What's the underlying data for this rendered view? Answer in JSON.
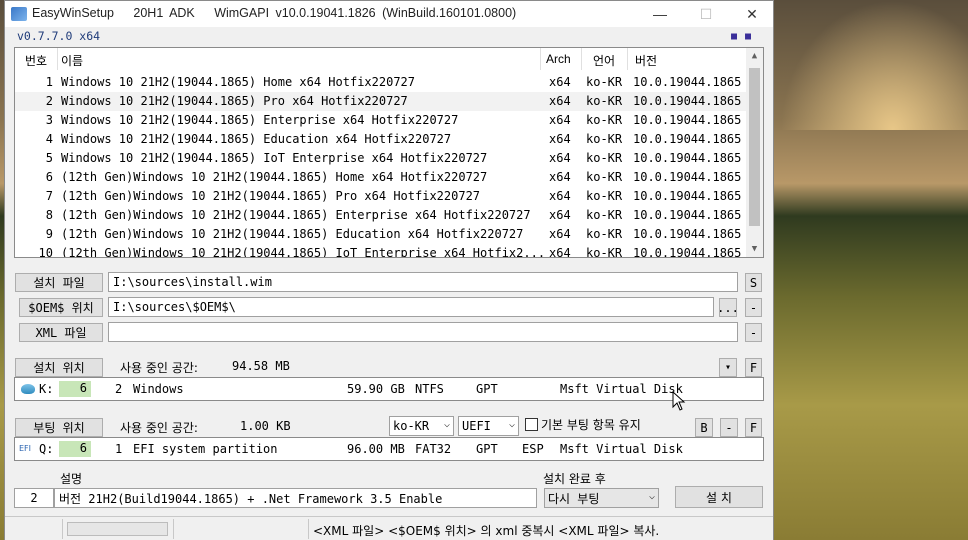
{
  "window": {
    "title": "EasyWinSetup   20H1 ADK   WimGAPI v10.0.19041.1826 (WinBuild.160101.0800)",
    "minimize": "—",
    "maximize": "☐",
    "close": "✕"
  },
  "version": "v0.7.7.0 x64",
  "menu_dots": "■■",
  "list": {
    "headers": {
      "no": "번호",
      "name": "이름",
      "arch": "Arch",
      "lang": "언어",
      "ver": "버전"
    },
    "rows": [
      {
        "no": "1",
        "name": "Windows 10 21H2(19044.1865) Home x64 Hotfix220727",
        "arch": "x64",
        "lang": "ko-KR",
        "ver": "10.0.19044.1865"
      },
      {
        "no": "2",
        "name": "Windows 10 21H2(19044.1865) Pro x64 Hotfix220727",
        "arch": "x64",
        "lang": "ko-KR",
        "ver": "10.0.19044.1865"
      },
      {
        "no": "3",
        "name": "Windows 10 21H2(19044.1865) Enterprise x64 Hotfix220727",
        "arch": "x64",
        "lang": "ko-KR",
        "ver": "10.0.19044.1865"
      },
      {
        "no": "4",
        "name": "Windows 10 21H2(19044.1865) Education x64 Hotfix220727",
        "arch": "x64",
        "lang": "ko-KR",
        "ver": "10.0.19044.1865"
      },
      {
        "no": "5",
        "name": "Windows 10 21H2(19044.1865) IoT Enterprise x64 Hotfix220727",
        "arch": "x64",
        "lang": "ko-KR",
        "ver": "10.0.19044.1865"
      },
      {
        "no": "6",
        "name": "(12th Gen)Windows 10 21H2(19044.1865) Home x64 Hotfix220727",
        "arch": "x64",
        "lang": "ko-KR",
        "ver": "10.0.19044.1865"
      },
      {
        "no": "7",
        "name": "(12th Gen)Windows 10 21H2(19044.1865) Pro x64 Hotfix220727",
        "arch": "x64",
        "lang": "ko-KR",
        "ver": "10.0.19044.1865"
      },
      {
        "no": "8",
        "name": "(12th Gen)Windows 10 21H2(19044.1865) Enterprise x64 Hotfix220727",
        "arch": "x64",
        "lang": "ko-KR",
        "ver": "10.0.19044.1865"
      },
      {
        "no": "9",
        "name": "(12th Gen)Windows 10 21H2(19044.1865) Education x64 Hotfix220727",
        "arch": "x64",
        "lang": "ko-KR",
        "ver": "10.0.19044.1865"
      },
      {
        "no": "10",
        "name": "(12th Gen)Windows 10 21H2(19044.1865) IoT Enterprise x64 Hotfix2...",
        "arch": "x64",
        "lang": "ko-KR",
        "ver": "10.0.19044.1865"
      }
    ],
    "selected_index": 1
  },
  "install_file": {
    "button": "설치 파일",
    "value": "I:\\sources\\install.wim",
    "s_button": "S"
  },
  "oem": {
    "button": "$OEM$ 위치",
    "value": "I:\\sources\\$OEM$\\",
    "browse": "...",
    "minus": "-"
  },
  "xml": {
    "button": "XML 파일",
    "value": "",
    "minus": "-"
  },
  "install_location": {
    "button": "설치 위치",
    "space_label": "사용 중인 공간:",
    "space_value": "94.58 MB",
    "dropdown": "▾",
    "f_button": "F",
    "drive": {
      "letter": "K:",
      "disk": "6",
      "part": "2",
      "label": "Windows",
      "size": "59.90 GB",
      "fs": "NTFS",
      "style": "GPT",
      "type": "",
      "model": "Msft Virtual Disk"
    }
  },
  "boot_location": {
    "button": "부팅 위치",
    "space_label": "사용 중인 공간:",
    "space_value": "1.00 KB",
    "lang_select": "ko-KR",
    "mode_select": "UEFI",
    "default_boot_label": "기본 부팅 항목 유지",
    "default_boot_checked": false,
    "b_button": "B",
    "minus": "-",
    "f_button": "F",
    "drive": {
      "icon_text": "EFI",
      "letter": "Q:",
      "disk": "6",
      "part": "1",
      "label": "EFI system partition",
      "size": "96.00 MB",
      "fs": "FAT32",
      "style": "GPT",
      "type": "ESP",
      "model": "Msft Virtual Disk"
    }
  },
  "description": {
    "label": "설명",
    "index": "2",
    "value": "버전 21H2(Build19044.1865) + .Net Framework 3.5 Enable"
  },
  "after_install": {
    "label": "설치 완료 후",
    "value": "다시 부팅"
  },
  "install_button": "설 치",
  "status": {
    "message": "<XML 파일> <$OEM$ 위치> 의 xml 중복시 <XML 파일> 복사."
  }
}
